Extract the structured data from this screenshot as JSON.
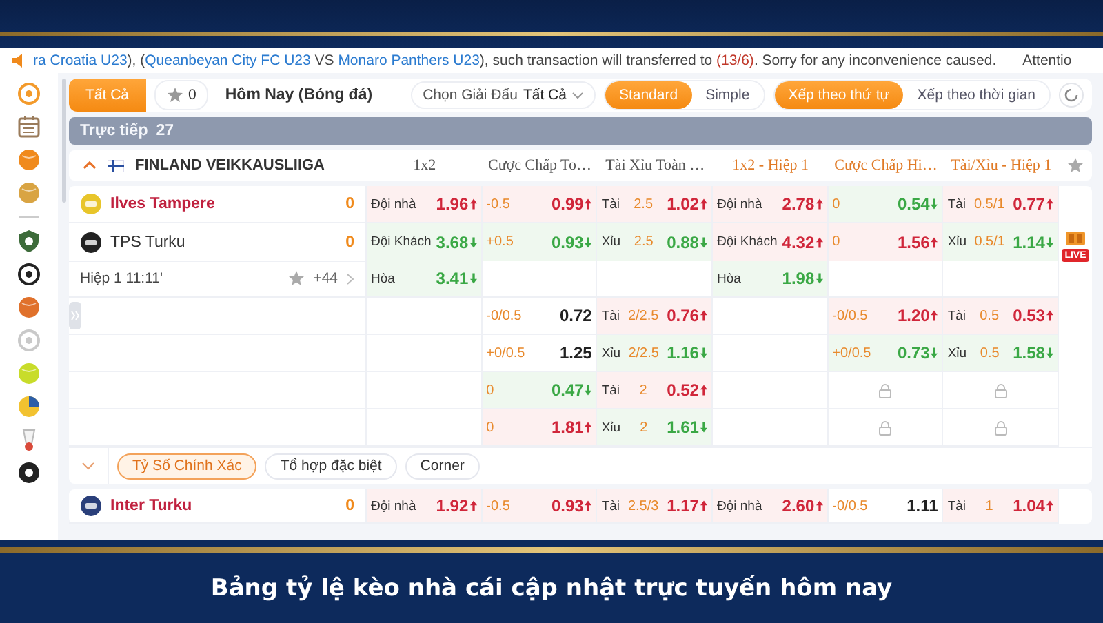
{
  "notice": {
    "parts": [
      {
        "kind": "team",
        "text": "ra Croatia U23"
      },
      {
        "kind": "plain",
        "text": "), ("
      },
      {
        "kind": "team",
        "text": "Queanbeyan City FC U23"
      },
      {
        "kind": "plain",
        "text": " VS "
      },
      {
        "kind": "team",
        "text": "Monaro Panthers U23"
      },
      {
        "kind": "plain",
        "text": "), such transaction will transferred to "
      },
      {
        "kind": "date",
        "text": "(13/6)"
      },
      {
        "kind": "plain",
        "text": ". Sorry for any inconvenience caused."
      }
    ],
    "next": "Attentio"
  },
  "toolbar": {
    "filters": [
      {
        "label": "Tất Cả",
        "selected": true
      }
    ],
    "favorites_count": "0",
    "title": "Hôm Nay (Bóng đá)",
    "league_picker": {
      "label": "Chọn Giải Đấu",
      "value": "Tất Cả"
    },
    "view_modes": [
      {
        "label": "Standard",
        "selected": true
      },
      {
        "label": "Simple",
        "selected": false
      }
    ],
    "sort_modes": [
      {
        "label": "Xếp theo thứ tự",
        "selected": true
      },
      {
        "label": "Xếp theo thời gian",
        "selected": false
      }
    ]
  },
  "section": {
    "label": "Trực tiếp",
    "count": "27"
  },
  "league": {
    "name": "FINLAND VEIKKAUSLIIGA",
    "expanded": true,
    "columns": [
      {
        "label": "1x2",
        "kind": "full"
      },
      {
        "label": "Cược Chấp To…",
        "kind": "full"
      },
      {
        "label": "Tài Xỉu Toàn …",
        "kind": "full"
      },
      {
        "label": "1x2 - Hiệp 1",
        "kind": "half"
      },
      {
        "label": "Cược Chấp Hi…",
        "kind": "half"
      },
      {
        "label": "Tài/Xỉu - Hiệp 1",
        "kind": "half"
      }
    ]
  },
  "match": {
    "home": {
      "name": "Ilves Tampere",
      "score": "0"
    },
    "away": {
      "name": "TPS Turku",
      "score": "0"
    },
    "time": "Hiệp 1 11:11'",
    "more_markets": "+44",
    "live_badge": "LIVE",
    "rows": [
      {
        "cells": [
          {
            "kind": "odds",
            "label": "Đội nhà",
            "odds": "1.96",
            "rising": true
          },
          {
            "kind": "odds",
            "line": "-0.5",
            "odds": "0.99",
            "rising": true
          },
          {
            "kind": "odds",
            "label": "Tài",
            "line": "2.5",
            "odds": "1.02",
            "rising": true
          },
          {
            "kind": "odds",
            "label": "Đội nhà",
            "odds": "2.78",
            "rising": true
          },
          {
            "kind": "odds",
            "line": "0",
            "odds": "0.54",
            "rising": false
          },
          {
            "kind": "odds",
            "label": "Tài",
            "line": "0.5/1",
            "odds": "0.77",
            "rising": true
          }
        ]
      },
      {
        "cells": [
          {
            "kind": "odds",
            "label": "Đội Khách",
            "odds": "3.68",
            "rising": false
          },
          {
            "kind": "odds",
            "line": "+0.5",
            "odds": "0.93",
            "rising": false
          },
          {
            "kind": "odds",
            "label": "Xỉu",
            "line": "2.5",
            "odds": "0.88",
            "rising": false
          },
          {
            "kind": "odds",
            "label": "Đội Khách",
            "odds": "4.32",
            "rising": true
          },
          {
            "kind": "odds",
            "line": "0",
            "odds": "1.56",
            "rising": true
          },
          {
            "kind": "odds",
            "label": "Xỉu",
            "line": "0.5/1",
            "odds": "1.14",
            "rising": false
          }
        ]
      },
      {
        "cells": [
          {
            "kind": "odds",
            "label": "Hòa",
            "odds": "3.41",
            "rising": false
          },
          {
            "kind": "empty"
          },
          {
            "kind": "empty"
          },
          {
            "kind": "odds",
            "label": "Hòa",
            "odds": "1.98",
            "rising": false
          },
          {
            "kind": "empty"
          },
          {
            "kind": "empty"
          }
        ]
      },
      {
        "cells": [
          {
            "kind": "empty"
          },
          {
            "kind": "odds",
            "line": "-0/0.5",
            "odds": "0.72"
          },
          {
            "kind": "odds",
            "label": "Tài",
            "line": "2/2.5",
            "odds": "0.76",
            "rising": true
          },
          {
            "kind": "empty"
          },
          {
            "kind": "odds",
            "line": "-0/0.5",
            "odds": "1.20",
            "rising": true
          },
          {
            "kind": "odds",
            "label": "Tài",
            "line": "0.5",
            "odds": "0.53",
            "rising": true
          }
        ]
      },
      {
        "cells": [
          {
            "kind": "empty"
          },
          {
            "kind": "odds",
            "line": "+0/0.5",
            "odds": "1.25"
          },
          {
            "kind": "odds",
            "label": "Xỉu",
            "line": "2/2.5",
            "odds": "1.16",
            "rising": false
          },
          {
            "kind": "empty"
          },
          {
            "kind": "odds",
            "line": "+0/0.5",
            "odds": "0.73",
            "rising": false
          },
          {
            "kind": "odds",
            "label": "Xỉu",
            "line": "0.5",
            "odds": "1.58",
            "rising": false
          }
        ]
      },
      {
        "cells": [
          {
            "kind": "empty"
          },
          {
            "kind": "odds",
            "line": "0",
            "odds": "0.47",
            "rising": false
          },
          {
            "kind": "odds",
            "label": "Tài",
            "line": "2",
            "odds": "0.52",
            "rising": true
          },
          {
            "kind": "empty"
          },
          {
            "kind": "locked"
          },
          {
            "kind": "locked"
          }
        ]
      },
      {
        "cells": [
          {
            "kind": "empty"
          },
          {
            "kind": "odds",
            "line": "0",
            "odds": "1.81",
            "rising": true
          },
          {
            "kind": "odds",
            "label": "Xỉu",
            "line": "2",
            "odds": "1.61",
            "rising": false
          },
          {
            "kind": "empty"
          },
          {
            "kind": "locked"
          },
          {
            "kind": "locked"
          }
        ]
      }
    ],
    "market_tabs": [
      {
        "label": "Tỷ Số Chính Xác",
        "selected": true
      },
      {
        "label": "Tổ hợp đặc biệt",
        "selected": false
      },
      {
        "label": "Corner",
        "selected": false
      }
    ]
  },
  "next_match": {
    "home": {
      "name": "Inter Turku",
      "score": "0"
    },
    "cells": [
      {
        "kind": "odds",
        "label": "Đội nhà",
        "odds": "1.92",
        "rising": true
      },
      {
        "kind": "odds",
        "line": "-0.5",
        "odds": "0.93",
        "rising": true
      },
      {
        "kind": "odds",
        "label": "Tài",
        "line": "2.5/3",
        "odds": "1.17",
        "rising": true
      },
      {
        "kind": "odds",
        "label": "Đội nhà",
        "odds": "2.60",
        "rising": true
      },
      {
        "kind": "odds",
        "line": "-0/0.5",
        "odds": "1.11"
      },
      {
        "kind": "odds",
        "label": "Tài",
        "line": "1",
        "odds": "1.04",
        "rising": true
      }
    ]
  },
  "caption": "Bảng tỷ lệ kèo nhà cái cập nhật trực tuyến hôm nay"
}
